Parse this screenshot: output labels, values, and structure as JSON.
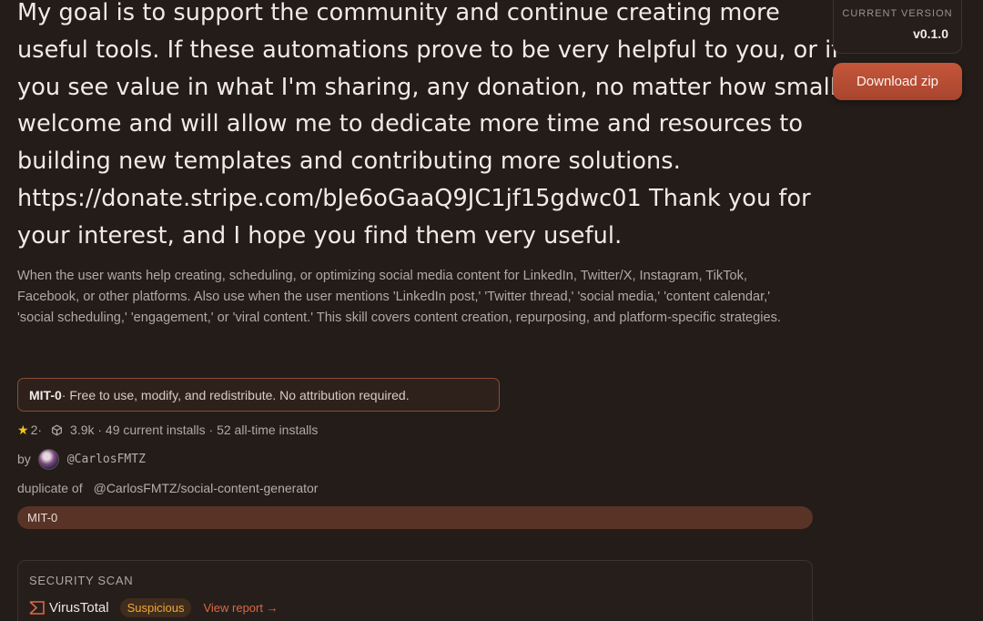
{
  "headline_lines": [
    "My goal is to support the community and continue creating more",
    "useful tools. If these automations prove to be very helpful to you, or if",
    "you see value in what I'm sharing, any donation, no matter how small, is",
    "welcome and will allow me to dedicate more time and resources to",
    "building new templates and contributing more solutions.",
    "https://donate.stripe.com/bJe6oGaaQ9JC1jf15gdwc01 Thank you for",
    "your interest, and I hope you find them very useful."
  ],
  "summary": "When the user wants help creating, scheduling, or optimizing social media content for LinkedIn, Twitter/X, Instagram, TikTok, Facebook, or other platforms. Also use when the user mentions 'LinkedIn post,' 'Twitter thread,' 'social media,' 'content calendar,' 'social scheduling,' 'engagement,' or 'viral content.' This skill covers content creation, repurposing, and platform-specific strategies.",
  "license": {
    "name": "MIT-0",
    "description": " · Free to use, modify, and redistribute. No attribution required."
  },
  "stats": {
    "stars": "2",
    "star_sep": " ·",
    "installs": "3.9k · 49 current installs · 52 all-time installs"
  },
  "author": {
    "by_label": "by",
    "handle": "@CarlosFMTZ"
  },
  "duplicate": {
    "label": "duplicate of",
    "link": "@CarlosFMTZ/social-content-generator"
  },
  "tag": "MIT-0",
  "security_scan": {
    "title": "SECURITY SCAN",
    "provider": "VirusTotal",
    "status": "Suspicious",
    "link": "View report →"
  },
  "version": {
    "label": "CURRENT VERSION",
    "value": "v0.1.0"
  },
  "download_label": "Download zip",
  "colors": {
    "background": "#231c19",
    "accent": "#c4563a",
    "suspicious": "#f0a93a",
    "link": "#d96a45"
  },
  "icons": [
    "star-icon",
    "package-icon",
    "avatar",
    "virustotal-icon"
  ]
}
